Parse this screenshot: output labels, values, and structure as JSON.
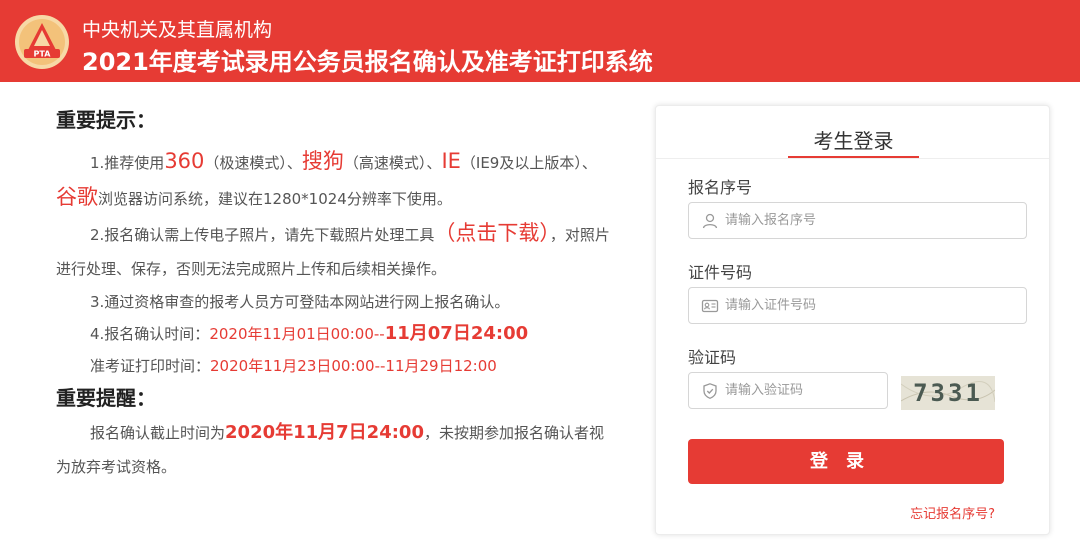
{
  "header": {
    "subtitle": "中央机关及其直属机构",
    "title": "2021年度考试录用公务员报名确认及准考证打印系统",
    "logo_text": "PTA",
    "brand_color": "#e63b34"
  },
  "notice": {
    "heading1": "重要提示：",
    "p1": {
      "a": "1.推荐使用",
      "b": "360",
      "c": "（极速模式）、",
      "d": "搜狗",
      "e": "（高速模式）、",
      "f": "IE",
      "g": "（IE9及以上版本）、",
      "h": "谷歌",
      "i": "浏览器访问系统，建议在1280*1024分辨率下使用。"
    },
    "p2": {
      "a": "2.报名确认需上传电子照片，请先下载照片处理工具",
      "link": "（点击下载）",
      "b": "，对照片进行处理、保存，否则无法完成照片上传和后续相关操作。"
    },
    "p3": "3.通过资格审查的报考人员方可登陆本网站进行网上报名确认。",
    "p4": {
      "label": "4.报名确认时间：",
      "start": "2020年11月01日00:00--",
      "end": "11月07日24:00"
    },
    "p5": {
      "label": "准考证打印时间：",
      "value": "2020年11月23日00:00--11月29日12:00"
    },
    "heading2": "重要提醒：",
    "p6": {
      "a": "报名确认截止时间为",
      "b": "2020年11月7日24:00",
      "c": "，未按期参加报名确认者视为放弃考试资格。"
    }
  },
  "login": {
    "title": "考生登录",
    "reg_label": "报名序号",
    "reg_placeholder": "请输入报名序号",
    "reg_value": "",
    "id_label": "证件号码",
    "id_placeholder": "请输入证件号码",
    "id_value": "",
    "code_label": "验证码",
    "code_placeholder": "请输入验证码",
    "code_value": "",
    "captcha_text": "7331",
    "submit": "登录",
    "forgot": "忘记报名序号?"
  }
}
